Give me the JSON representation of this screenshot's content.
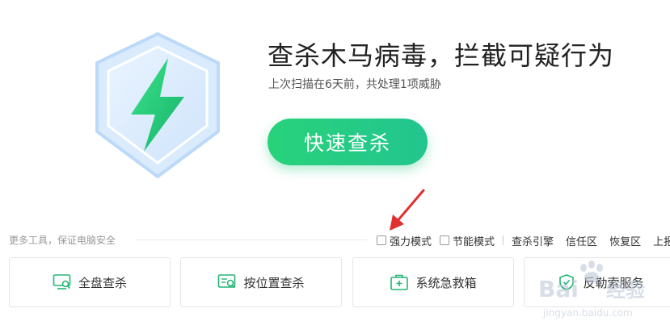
{
  "hero": {
    "headline": "查杀木马病毒，拦截可疑行为",
    "subline": "上次扫描在6天前，共处理1项威胁",
    "scan_button": "快速查杀"
  },
  "tools_bar": {
    "label": "更多工具，保证电脑安全",
    "checkboxes": [
      {
        "label": "强力模式",
        "checked": false
      },
      {
        "label": "节能模式",
        "checked": false
      }
    ],
    "links": [
      "查杀引擎",
      "信任区",
      "恢复区",
      "上报"
    ]
  },
  "tools": [
    {
      "label": "全盘查杀",
      "icon": "monitor-scan-icon"
    },
    {
      "label": "按位置查杀",
      "icon": "location-scan-icon"
    },
    {
      "label": "系统急救箱",
      "icon": "first-aid-kit-icon"
    },
    {
      "label": "反勒索服务",
      "icon": "anti-ransomware-icon"
    }
  ],
  "watermark": {
    "brand": "Baidu经验",
    "url": "jingyan.baidu.com"
  },
  "colors": {
    "accent": "#22c88a",
    "annotation_arrow": "#e03030"
  }
}
